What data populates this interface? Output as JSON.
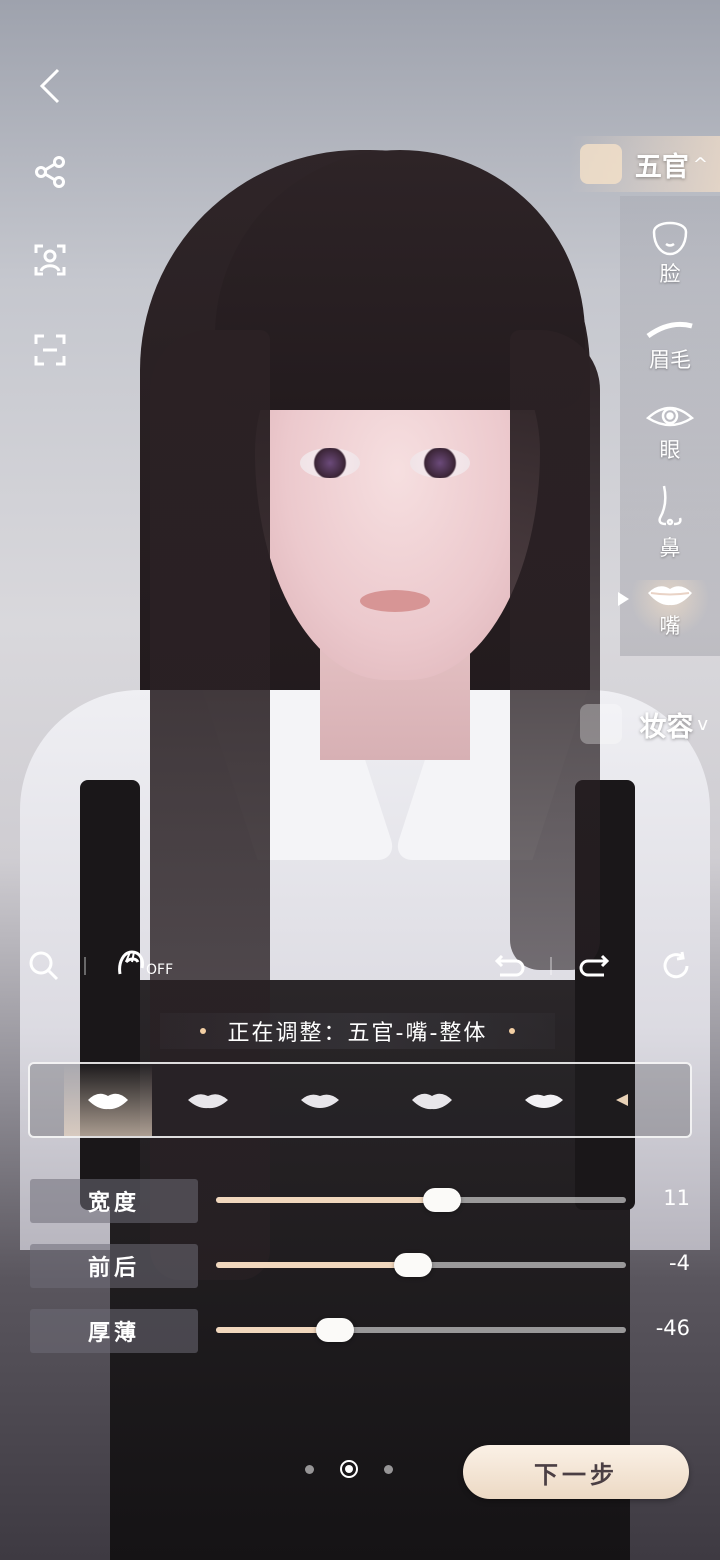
{
  "left_tools": {
    "back": "back-icon",
    "share": "share-icon",
    "face_scan": "face-scan-icon",
    "fullscreen": "frame-icon"
  },
  "right_menu": {
    "category_active": {
      "label": "五官",
      "chevron": "^"
    },
    "parts": [
      {
        "label": "脸",
        "icon": "face-outline-icon"
      },
      {
        "label": "眉毛",
        "icon": "eyebrow-icon"
      },
      {
        "label": "眼",
        "icon": "eye-icon"
      },
      {
        "label": "鼻",
        "icon": "nose-icon"
      },
      {
        "label": "嘴",
        "icon": "lips-icon",
        "selected": true
      }
    ],
    "category_makeup": {
      "label": "妆容",
      "chevron": "v"
    }
  },
  "toolbar": {
    "search_icon": "search-icon",
    "hair_toggle_label": "OFF",
    "undo_icon": "undo-icon",
    "redo_icon": "redo-icon",
    "reset_icon": "reset-icon"
  },
  "adjusting": {
    "text": "正在调整：五官-嘴-整体"
  },
  "presets": {
    "count": 5,
    "selected_index": 0
  },
  "sliders": [
    {
      "label": "宽度",
      "value": "11",
      "fraction": 0.55
    },
    {
      "label": "前后",
      "value": "-4",
      "fraction": 0.48
    },
    {
      "label": "厚薄",
      "value": "-46",
      "fraction": 0.29
    }
  ],
  "pager": {
    "pages": 3,
    "current": 2
  },
  "next_button": {
    "label": "下一步"
  },
  "colors": {
    "accent": "#f1d7bd",
    "button_text": "#4b3f44"
  }
}
